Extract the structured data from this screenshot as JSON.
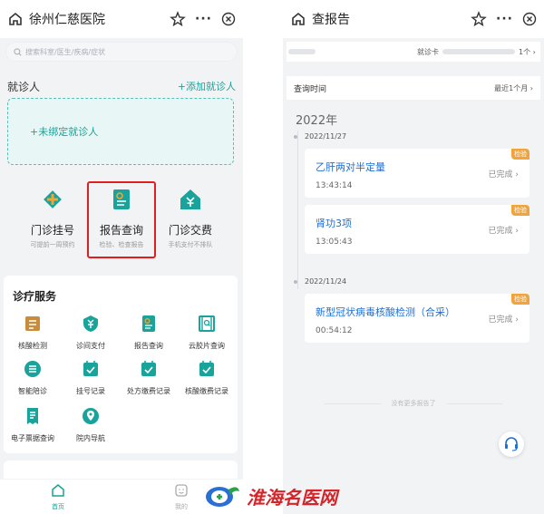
{
  "left": {
    "title": "徐州仁慈医院",
    "more_label": "···",
    "search_placeholder": "搜索科室/医生/疾病/症状",
    "patient_label": "就诊人",
    "add_patient": "+添加就诊人",
    "unbound": "+未绑定就诊人",
    "quick": [
      {
        "name": "门诊挂号",
        "sub": "可提前一周预约",
        "icon": "hospital-cross-icon"
      },
      {
        "name": "报告查询",
        "sub": "检验、检查报告",
        "icon": "report-doc-icon"
      },
      {
        "name": "门诊交费",
        "sub": "手机支付不排队",
        "icon": "house-payment-icon"
      }
    ],
    "services_title": "诊疗服务",
    "services": [
      {
        "name": "核酸检测",
        "icon": "nucleic-test-icon"
      },
      {
        "name": "诊间支付",
        "icon": "yuan-shield-icon"
      },
      {
        "name": "报告查询",
        "icon": "report-icon"
      },
      {
        "name": "云胶片查询",
        "icon": "film-search-icon"
      },
      {
        "name": "智能陪诊",
        "icon": "list-circle-icon"
      },
      {
        "name": "挂号记录",
        "icon": "calendar-check-icon"
      },
      {
        "name": "处方缴费记录",
        "icon": "calendar-check-icon"
      },
      {
        "name": "核酸缴费记录",
        "icon": "calendar-check-icon"
      },
      {
        "name": "电子票据查询",
        "icon": "receipt-icon"
      },
      {
        "name": "院内导航",
        "icon": "navigation-icon"
      }
    ],
    "tabs": [
      {
        "name": "首页",
        "icon": "home-icon"
      },
      {
        "name": "我的",
        "icon": "smile-face-icon"
      }
    ],
    "accent": "#1aa39a"
  },
  "right": {
    "title": "查报告",
    "more_label": "···",
    "card_label": "就诊卡",
    "card_count": "1个",
    "query_label": "查询时间",
    "query_value": "最近1个月",
    "year": "2022年",
    "groups": [
      {
        "date": "2022/11/27"
      },
      {
        "date": "2022/11/24"
      }
    ],
    "reports": [
      {
        "title": "乙肝两对半定量",
        "time": "13:43:14",
        "status": "已完成",
        "tag": "检验"
      },
      {
        "title": "肾功3项",
        "time": "13:05:43",
        "status": "已完成",
        "tag": "检验"
      },
      {
        "title": "新型冠状病毒核酸检测（合采）",
        "time": "00:54:12",
        "status": "已完成",
        "tag": "检验"
      }
    ],
    "no_more": "没有更多报告了",
    "link_color": "#1f6fd1",
    "tag_color": "#f0a43a"
  },
  "watermark": "淮海名医网"
}
